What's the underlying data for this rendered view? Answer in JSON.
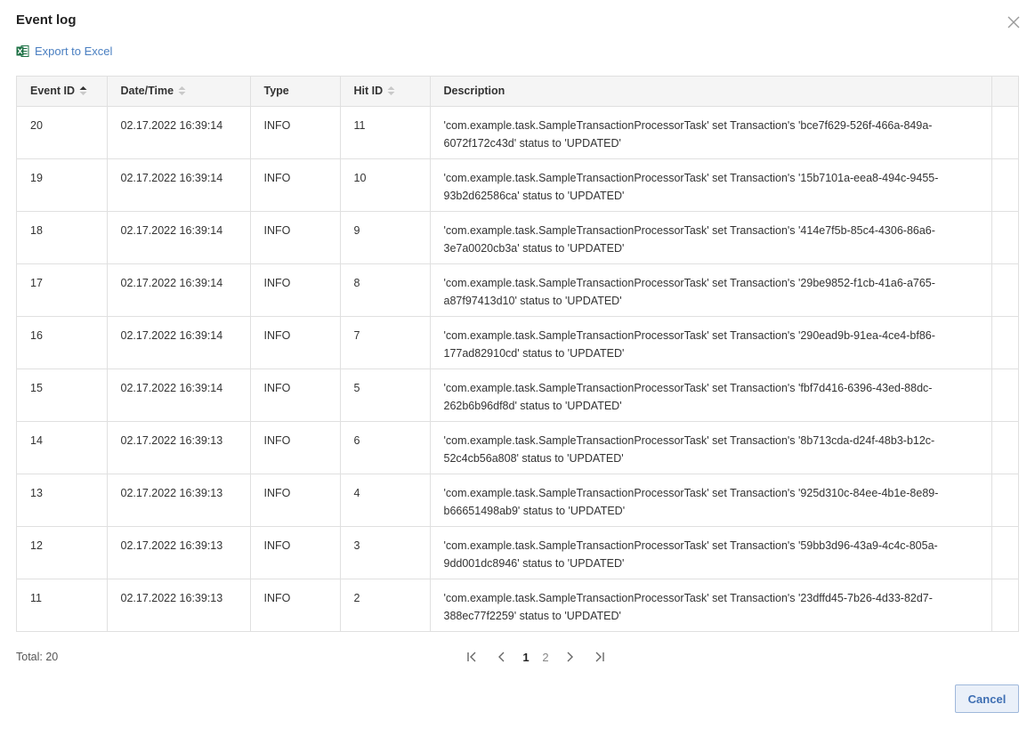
{
  "dialog": {
    "title": "Event log",
    "export_label": "Export to Excel",
    "icons": {
      "export": "excel-icon",
      "close": "close-icon"
    }
  },
  "table": {
    "columns": [
      {
        "label": "Event ID",
        "sort": "ascending"
      },
      {
        "label": "Date/Time",
        "sort": "none"
      },
      {
        "label": "Type",
        "sort": null
      },
      {
        "label": "Hit ID",
        "sort": "none"
      },
      {
        "label": "Description",
        "sort": null
      }
    ],
    "rows": [
      {
        "event_id": "20",
        "datetime": "02.17.2022 16:39:14",
        "type": "INFO",
        "hit_id": "11",
        "description": "'com.example.task.SampleTransactionProcessorTask' set Transaction's 'bce7f629-526f-466a-849a-6072f172c43d' status to 'UPDATED'"
      },
      {
        "event_id": "19",
        "datetime": "02.17.2022 16:39:14",
        "type": "INFO",
        "hit_id": "10",
        "description": "'com.example.task.SampleTransactionProcessorTask' set Transaction's '15b7101a-eea8-494c-9455-93b2d62586ca' status to 'UPDATED'"
      },
      {
        "event_id": "18",
        "datetime": "02.17.2022 16:39:14",
        "type": "INFO",
        "hit_id": "9",
        "description": "'com.example.task.SampleTransactionProcessorTask' set Transaction's '414e7f5b-85c4-4306-86a6-3e7a0020cb3a' status to 'UPDATED'"
      },
      {
        "event_id": "17",
        "datetime": "02.17.2022 16:39:14",
        "type": "INFO",
        "hit_id": "8",
        "description": "'com.example.task.SampleTransactionProcessorTask' set Transaction's '29be9852-f1cb-41a6-a765-a87f97413d10' status to 'UPDATED'"
      },
      {
        "event_id": "16",
        "datetime": "02.17.2022 16:39:14",
        "type": "INFO",
        "hit_id": "7",
        "description": "'com.example.task.SampleTransactionProcessorTask' set Transaction's '290ead9b-91ea-4ce4-bf86-177ad82910cd' status to 'UPDATED'"
      },
      {
        "event_id": "15",
        "datetime": "02.17.2022 16:39:14",
        "type": "INFO",
        "hit_id": "5",
        "description": "'com.example.task.SampleTransactionProcessorTask' set Transaction's 'fbf7d416-6396-43ed-88dc-262b6b96df8d' status to 'UPDATED'"
      },
      {
        "event_id": "14",
        "datetime": "02.17.2022 16:39:13",
        "type": "INFO",
        "hit_id": "6",
        "description": "'com.example.task.SampleTransactionProcessorTask' set Transaction's '8b713cda-d24f-48b3-b12c-52c4cb56a808' status to 'UPDATED'"
      },
      {
        "event_id": "13",
        "datetime": "02.17.2022 16:39:13",
        "type": "INFO",
        "hit_id": "4",
        "description": "'com.example.task.SampleTransactionProcessorTask' set Transaction's '925d310c-84ee-4b1e-8e89-b66651498ab9' status to 'UPDATED'"
      },
      {
        "event_id": "12",
        "datetime": "02.17.2022 16:39:13",
        "type": "INFO",
        "hit_id": "3",
        "description": "'com.example.task.SampleTransactionProcessorTask' set Transaction's '59bb3d96-43a9-4c4c-805a-9dd001dc8946' status to 'UPDATED'"
      },
      {
        "event_id": "11",
        "datetime": "02.17.2022 16:39:13",
        "type": "INFO",
        "hit_id": "2",
        "description": "'com.example.task.SampleTransactionProcessorTask' set Transaction's '23dffd45-7b26-4d33-82d7-388ec77f2259' status to 'UPDATED'"
      }
    ]
  },
  "footer": {
    "total": "Total: 20",
    "pagination": {
      "pages": [
        "1",
        "2"
      ],
      "current": "1"
    },
    "cancel_label": "Cancel"
  },
  "colors": {
    "accent": "#4a7fc1",
    "header_bg": "#f5f5f5",
    "border": "#e0e0e0",
    "excel_green": "#1e7145"
  }
}
